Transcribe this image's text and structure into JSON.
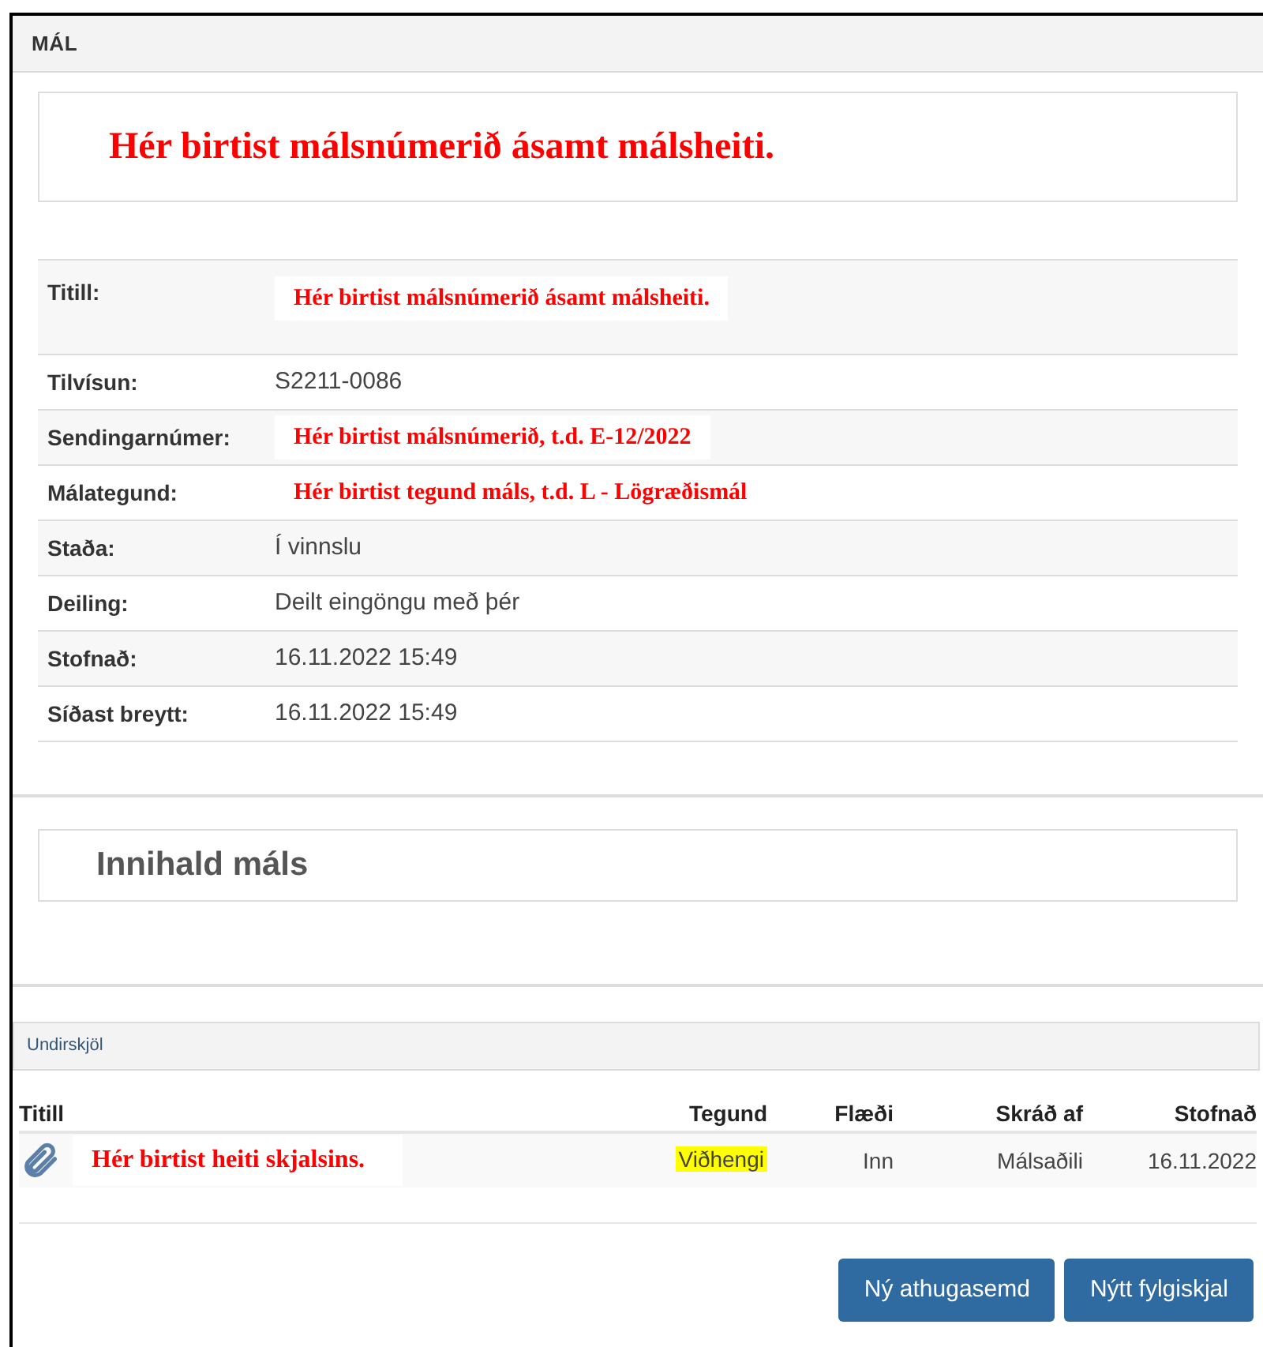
{
  "panel": {
    "title": "MÁL"
  },
  "heading": {
    "text": "Hér birtist málsnúmerið ásamt málsheiti.",
    "kind": "annotation"
  },
  "details": [
    {
      "label": "Titill:",
      "value": "Hér birtist málsnúmerið ásamt málsheiti.",
      "kind": "annotation"
    },
    {
      "label": "Tilvísun:",
      "value": "S2211-0086",
      "kind": "text"
    },
    {
      "label": "Sendingarnúmer:",
      "value": "Hér birtist málsnúmerið, t.d. E-12/2022",
      "kind": "annotation"
    },
    {
      "label": "Málategund:",
      "value": "Hér birtist tegund máls, t.d. L - Lögræðismál",
      "kind": "annotation"
    },
    {
      "label": "Staða:",
      "value": "Í vinnslu",
      "kind": "text"
    },
    {
      "label": "Deiling:",
      "value": "Deilt eingöngu með þér",
      "kind": "text"
    },
    {
      "label": "Stofnað:",
      "value": "16.11.2022 15:49",
      "kind": "text"
    },
    {
      "label": "Síðast breytt:",
      "value": "16.11.2022 15:49",
      "kind": "text"
    }
  ],
  "contents": {
    "title": "Innihald máls"
  },
  "subdocs": {
    "title": "Undirskjöl",
    "columns": [
      "Titill",
      "Tegund",
      "Flæði",
      "Skráð af",
      "Stofnað"
    ],
    "rows": [
      {
        "title": "Hér birtist heiti skjalsins.",
        "kind": "annotation",
        "type": "Viðhengi",
        "highlighted": true,
        "flow": "Inn",
        "registered_by": "Málsaðili",
        "created": "16.11.2022"
      }
    ]
  },
  "buttons": [
    "Ný athugasemd",
    "Nýtt fylgiskjal"
  ]
}
